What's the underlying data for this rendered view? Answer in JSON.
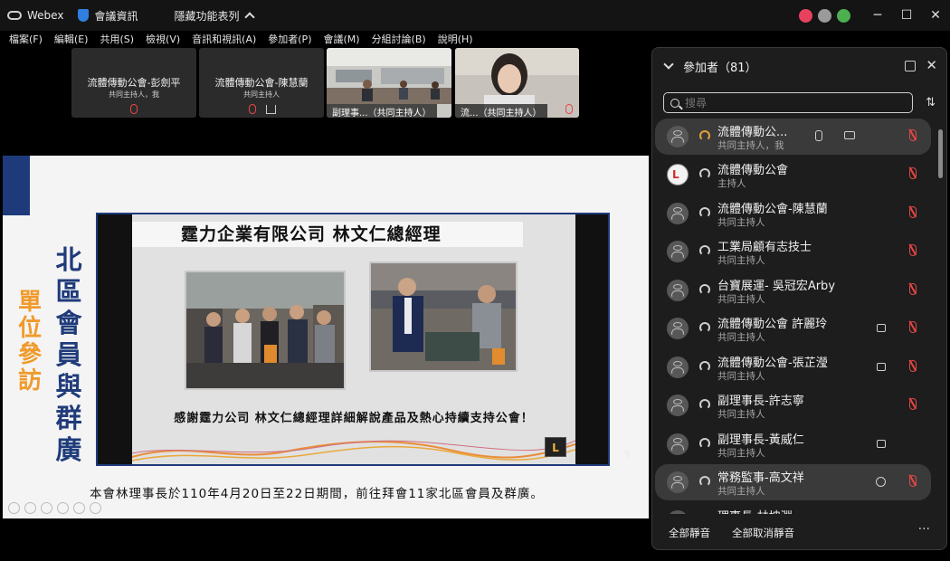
{
  "titlebar": {
    "app_name": "Webex",
    "meeting_info_label": "會議資訊",
    "hidden_features_label": "隱藏功能表列",
    "window_controls": [
      "─",
      "☐",
      "✕"
    ],
    "status_colors": [
      "#e8415d",
      "#9a9a9a",
      "#4caf50"
    ]
  },
  "menu": [
    "檔案(F)",
    "編輯(E)",
    "共用(S)",
    "檢視(V)",
    "音訊和視訊(A)",
    "參加者(P)",
    "會議(M)",
    "分組討論(B)",
    "說明(H)"
  ],
  "thumbnails": [
    {
      "name": "流體傳動公會-彭劍平",
      "role": "共同主持人，我",
      "type": "avatar"
    },
    {
      "name": "流體傳動公會-陳慧蘭",
      "role": "共同主持人",
      "type": "avatar"
    },
    {
      "caption": "副理事...（共同主持人）",
      "type": "video"
    },
    {
      "caption": "流...（共同主持人）",
      "type": "video"
    }
  ],
  "slide": {
    "vertical_orange": [
      "單",
      "位",
      "參",
      "訪"
    ],
    "vertical_navy": [
      "北",
      "區",
      "會",
      "員",
      "與",
      "群",
      "廣"
    ],
    "photo_title": "霆力企業有限公司 林文仁總經理",
    "photo_caption": "感謝霆力公司 林文仁總經理詳細解說產品及熱心持續支持公會！",
    "footer": "本會林理事長於110年4月20日至22日期間，前往拜會11家北區會員及群廣。",
    "logo_text": "L"
  },
  "panel": {
    "title": "參加者（81）",
    "search_placeholder": "搜尋",
    "participants": [
      {
        "name": "流體傳動公...",
        "role": "共同主持人，我",
        "icons": [
          "hand",
          "cc"
        ],
        "highlight": true
      },
      {
        "name": "流體傳動公會",
        "role": "主持人",
        "icons": [],
        "avatar": "logo"
      },
      {
        "name": "流體傳動公會-陳慧蘭",
        "role": "共同主持人",
        "icons": []
      },
      {
        "name": "工業局顧有志技士",
        "role": "共同主持人",
        "icons": []
      },
      {
        "name": "台寶展運- 吳冠宏Arby",
        "role": "共同主持人",
        "icons": []
      },
      {
        "name": "流體傳動公會 許麗玲",
        "role": "共同主持人",
        "icons": [
          "cam"
        ]
      },
      {
        "name": "流體傳動公會-張芷瀅",
        "role": "共同主持人",
        "icons": [
          "cam"
        ]
      },
      {
        "name": "副理事長-許志寧",
        "role": "共同主持人",
        "icons": []
      },
      {
        "name": "副理事長-黃威仁",
        "role": "共同主持人",
        "icons": [
          "cam"
        ],
        "nomic": true
      },
      {
        "name": "常務監事-高文祥",
        "role": "共同主持人",
        "icons": [
          "chat"
        ],
        "highlight": true
      },
      {
        "name": "理事長-林坤淵",
        "role": "",
        "icons": []
      }
    ],
    "mute_all": "全部靜音",
    "unmute_all": "全部取消靜音",
    "more": "···"
  }
}
